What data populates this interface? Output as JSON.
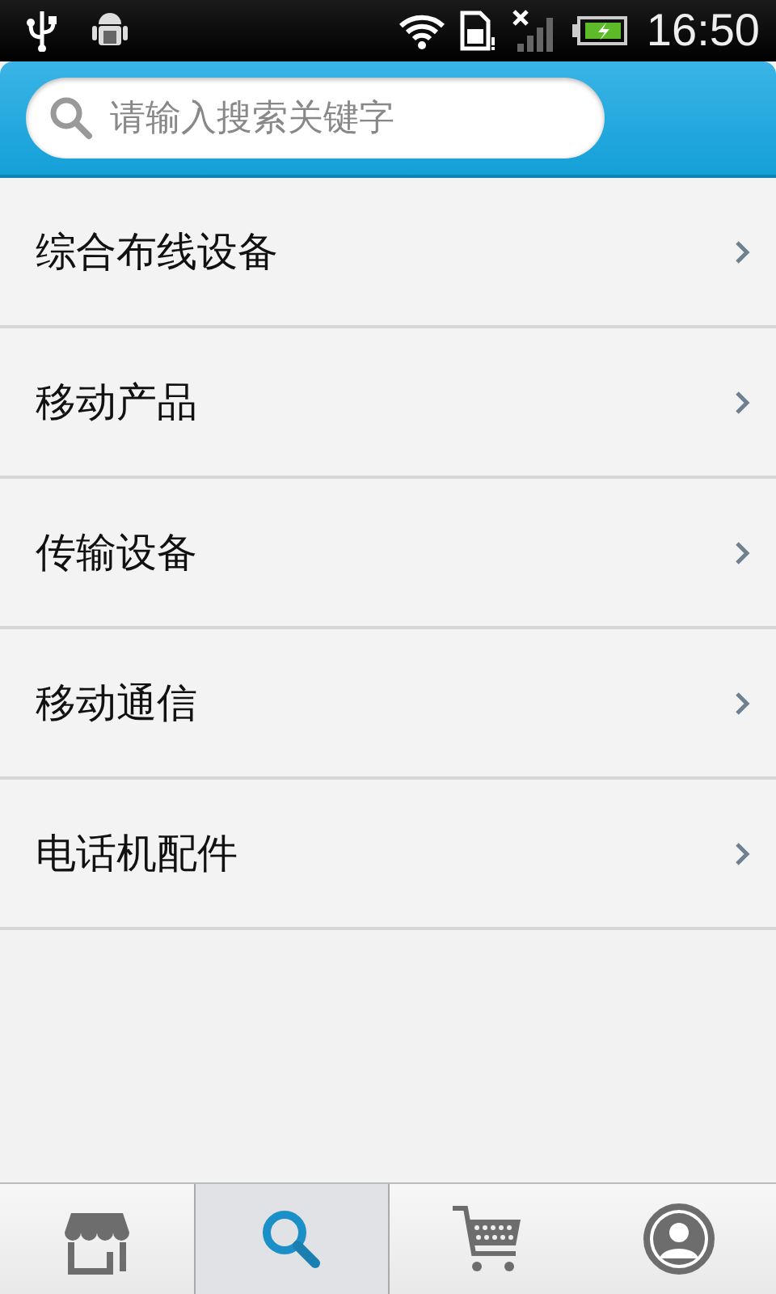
{
  "status_bar": {
    "time": "16:50"
  },
  "search": {
    "placeholder": "请输入搜索关键字"
  },
  "categories": [
    {
      "label": "综合布线设备"
    },
    {
      "label": "移动产品"
    },
    {
      "label": "传输设备"
    },
    {
      "label": "移动通信"
    },
    {
      "label": "电话机配件"
    }
  ],
  "tabs": [
    {
      "kind": "store",
      "selected": false
    },
    {
      "kind": "search",
      "selected": true
    },
    {
      "kind": "cart",
      "selected": false
    },
    {
      "kind": "profile",
      "selected": false
    }
  ]
}
